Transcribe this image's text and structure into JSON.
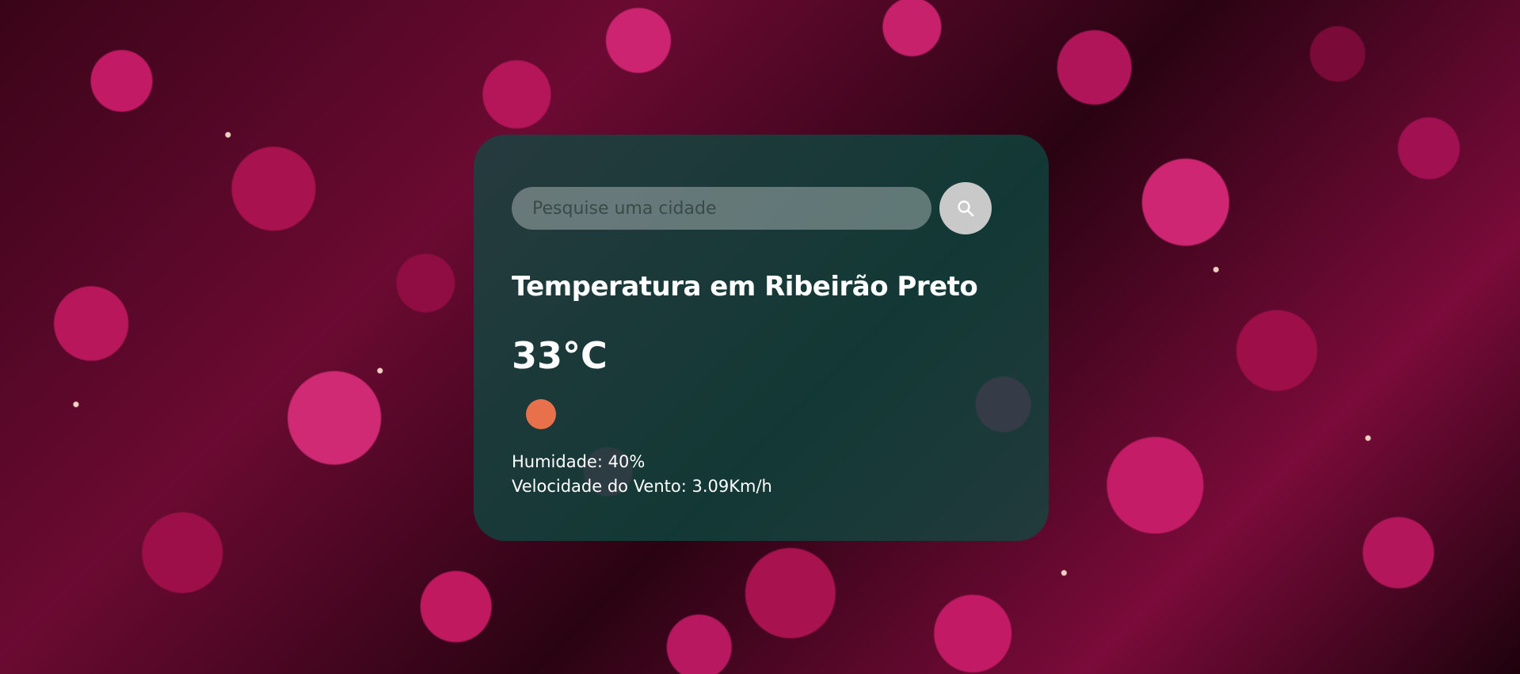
{
  "search": {
    "placeholder": "Pesquise uma cidade",
    "button_icon": "search-icon"
  },
  "weather": {
    "title": "Temperatura em Ribeirão Preto",
    "temperature": "33°C",
    "condition_icon": "sun-icon",
    "humidity": "Humidade: 40%",
    "wind": "Velocidade do Vento: 3.09Km/h"
  },
  "colors": {
    "card_background": "#0a4e42",
    "sun": "#e8704a",
    "search_button": "#c9c9c9",
    "background_flowers": "#b5165a"
  }
}
